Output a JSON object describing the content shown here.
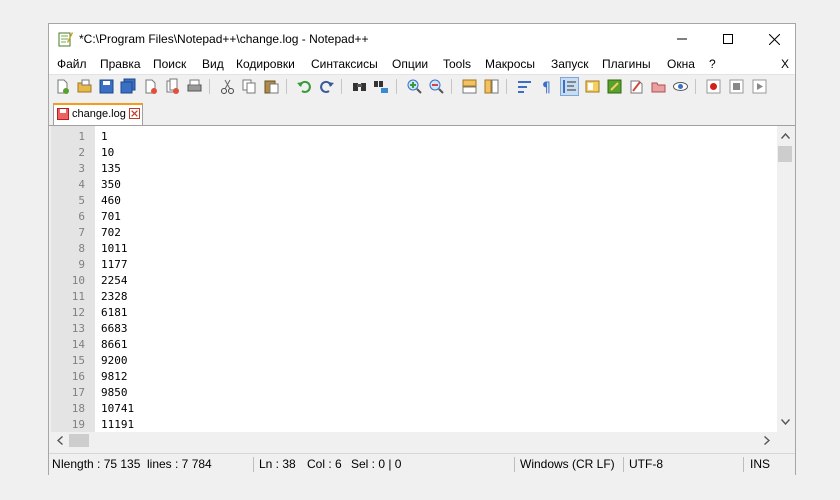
{
  "window": {
    "title": "*C:\\Program Files\\Notepad++\\change.log - Notepad++",
    "controls": {
      "minimize": "minimize",
      "maximize": "maximize",
      "close": "close"
    }
  },
  "menu": {
    "items": [
      "Файл",
      "Правка",
      "Поиск",
      "Вид",
      "Кодировки",
      "Синтаксисы",
      "Опции",
      "Tools",
      "Макросы",
      "Запуск",
      "Плагины",
      "Окна",
      "?"
    ],
    "close_doc": "X"
  },
  "toolbar": {
    "icons": [
      "new-file-icon",
      "open-file-icon",
      "save-icon",
      "save-all-icon",
      "close-file-icon",
      "close-all-icon",
      "print-icon",
      "cut-icon",
      "copy-icon",
      "paste-icon",
      "undo-icon",
      "redo-icon",
      "find-icon",
      "replace-icon",
      "zoom-in-icon",
      "zoom-out-icon",
      "sync-vertical-icon",
      "sync-horizontal-icon",
      "word-wrap-icon",
      "show-all-chars-icon",
      "indent-guide-icon",
      "doc-map-icon",
      "function-list-icon",
      "folder-as-workspace-icon",
      "monitoring-icon",
      "record-macro-icon",
      "stop-record-icon",
      "playback-macro-icon"
    ],
    "active": "indent-guide-icon",
    "accent": "#f59c1a"
  },
  "tabs": [
    {
      "label": "change.log",
      "modified": true
    }
  ],
  "editor": {
    "lines": [
      {
        "n": "1",
        "text": "1"
      },
      {
        "n": "2",
        "text": "10"
      },
      {
        "n": "3",
        "text": "135"
      },
      {
        "n": "4",
        "text": "350"
      },
      {
        "n": "5",
        "text": "460"
      },
      {
        "n": "6",
        "text": "701"
      },
      {
        "n": "7",
        "text": "702"
      },
      {
        "n": "8",
        "text": "1011"
      },
      {
        "n": "9",
        "text": "1177"
      },
      {
        "n": "10",
        "text": "2254"
      },
      {
        "n": "11",
        "text": "2328"
      },
      {
        "n": "12",
        "text": "6181"
      },
      {
        "n": "13",
        "text": "6683"
      },
      {
        "n": "14",
        "text": "8661"
      },
      {
        "n": "15",
        "text": "9200"
      },
      {
        "n": "16",
        "text": "9812"
      },
      {
        "n": "17",
        "text": "9850"
      },
      {
        "n": "18",
        "text": "10741"
      },
      {
        "n": "19",
        "text": "11191"
      }
    ]
  },
  "status": {
    "length": "length : 75 135",
    "lines": "lines : 7 784",
    "ln": "Ln : 38",
    "col": "Col : 6",
    "sel": "Sel : 0 | 0",
    "eol": "Windows (CR LF)",
    "encoding": "UTF-8",
    "mode": "INS"
  }
}
